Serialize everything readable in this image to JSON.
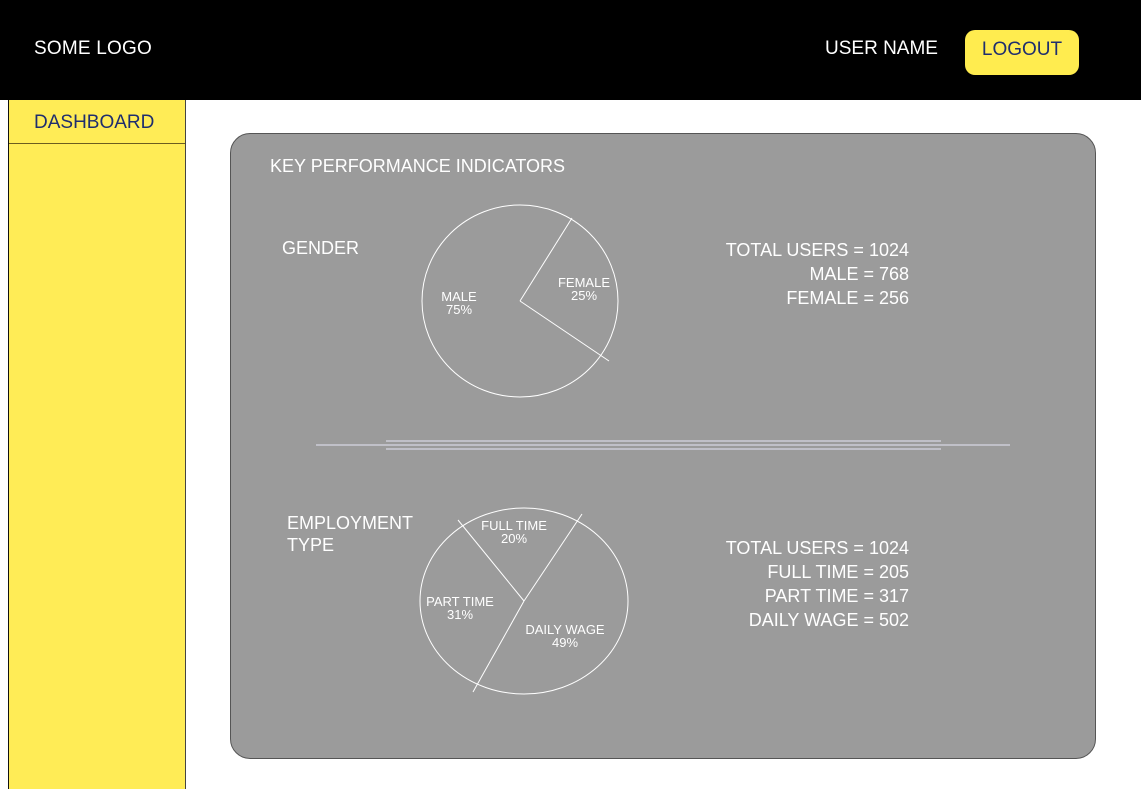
{
  "header": {
    "logo": "SOME LOGO",
    "user_name": "USER NAME",
    "logout_label": "LOGOUT"
  },
  "sidebar": {
    "items": [
      {
        "label": "DASHBOARD"
      }
    ]
  },
  "panel": {
    "title": "KEY PERFORMANCE INDICATORS",
    "gender": {
      "label": "GENDER",
      "slices": [
        {
          "name": "MALE",
          "percent": "75%"
        },
        {
          "name": "FEMALE",
          "percent": "25%"
        }
      ],
      "stats": [
        "TOTAL USERS = 1024",
        "MALE = 768",
        "FEMALE = 256"
      ]
    },
    "employment": {
      "label_line1": "EMPLOYMENT",
      "label_line2": "TYPE",
      "slices": [
        {
          "name": "FULL TIME",
          "percent": "20%"
        },
        {
          "name": "PART TIME",
          "percent": "31%"
        },
        {
          "name": "DAILY WAGE",
          "percent": "49%"
        }
      ],
      "stats": [
        "TOTAL USERS = 1024",
        "FULL TIME = 205",
        "PART TIME = 317",
        "DAILY WAGE = 502"
      ]
    }
  },
  "colors": {
    "topbar": "#000000",
    "accent_yellow": "#ffec4f",
    "panel_gray": "#9b9b9b",
    "text_navy": "#1f2e6e"
  }
}
